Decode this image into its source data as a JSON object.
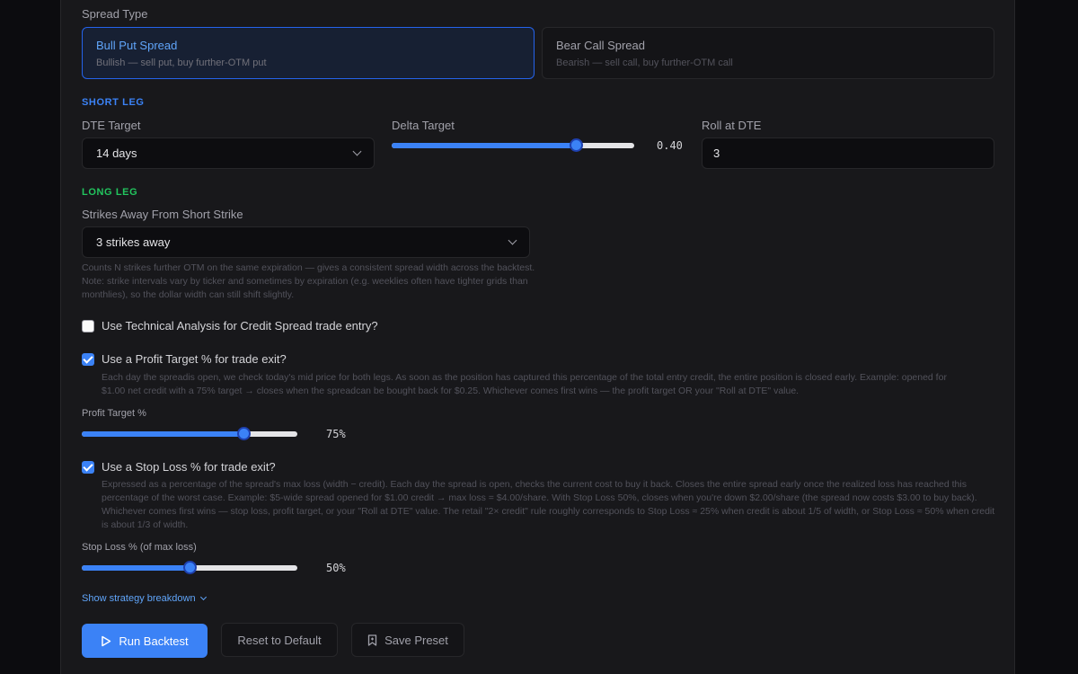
{
  "spread_type": {
    "label": "Spread Type",
    "options": [
      {
        "title": "Bull Put Spread",
        "subtitle": "Bullish — sell put, buy further-OTM put",
        "selected": true
      },
      {
        "title": "Bear Call Spread",
        "subtitle": "Bearish — sell call, buy further-OTM call",
        "selected": false
      }
    ]
  },
  "short_leg": {
    "section_title": "SHORT LEG",
    "dte_label": "DTE Target",
    "dte_value": "14 days",
    "delta_label": "Delta Target",
    "delta_value": "0.40",
    "delta_fraction": 0.76,
    "roll_label": "Roll at DTE",
    "roll_value": "3"
  },
  "long_leg": {
    "section_title": "LONG LEG",
    "strikes_label": "Strikes Away From Short Strike",
    "strikes_value": "3 strikes away",
    "help": "Counts N strikes further OTM on the same expiration — gives a consistent spread width across the backtest. Note: strike intervals vary by ticker and sometimes by expiration (e.g. weeklies often have tighter grids than monthlies), so the dollar width can still shift slightly."
  },
  "technical": {
    "label": "Use Technical Analysis for Credit Spread trade entry?",
    "checked": false
  },
  "profit_target": {
    "label": "Use a Profit Target % for trade exit?",
    "checked": true,
    "help": "Each day the spreadis open, we check today's mid price for both legs. As soon as the position has captured this percentage of the total entry credit, the entire position is closed early. Example: opened for $1.00 net credit with a 75% target → closes when the spreadcan be bought back for $0.25. Whichever comes first wins — the profit target OR your \"Roll at DTE\" value.",
    "slider_label": "Profit Target %",
    "value": "75%",
    "fraction": 0.75
  },
  "stop_loss": {
    "label": "Use a Stop Loss % for trade exit?",
    "checked": true,
    "help": "Expressed as a percentage of the spread's max loss (width − credit). Each day the spread is open, checks the current cost to buy it back. Closes the entire spread early once the realized loss has reached this percentage of the worst case. Example: $5-wide spread opened for $1.00 credit → max loss = $4.00/share. With Stop Loss 50%, closes when you're down $2.00/share (the spread now costs $3.00 to buy back). Whichever comes first wins — stop loss, profit target, or your \"Roll at DTE\" value. The retail \"2× credit\" rule roughly corresponds to Stop Loss ≈ 25% when credit is about 1/5 of width, or Stop Loss ≈ 50% when credit is about 1/3 of width.",
    "slider_label": "Stop Loss % (of max loss)",
    "value": "50%",
    "fraction": 0.5
  },
  "breakdown_link": "Show strategy breakdown",
  "actions": {
    "run": "Run Backtest",
    "reset": "Reset to Default",
    "save": "Save Preset"
  },
  "colors": {
    "accent": "#3b82f6",
    "short_leg": "#3b82f6",
    "long_leg": "#22c55e"
  },
  "icons": {
    "run": "play-icon",
    "save": "bookmark-icon",
    "chevron": "chevron-down-icon"
  }
}
